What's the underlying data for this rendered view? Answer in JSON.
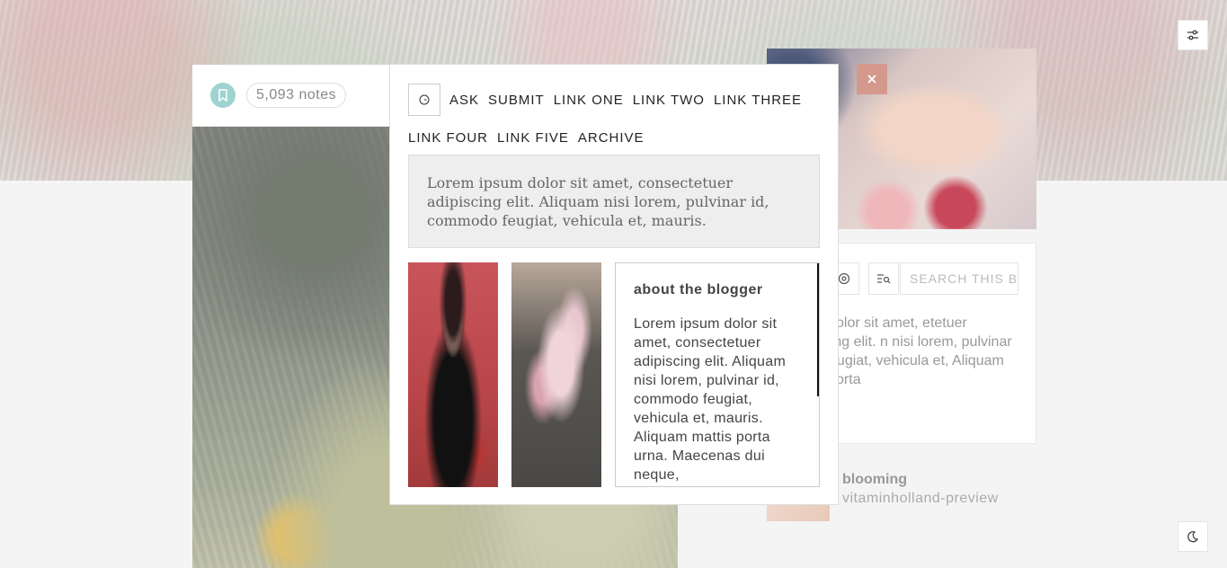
{
  "post": {
    "notes_label": "5,093 notes"
  },
  "modal": {
    "nav_links": [
      "ASK",
      "SUBMIT",
      "LINK ONE",
      "LINK TWO",
      "LINK THREE",
      "LINK FOUR",
      "LINK FIVE",
      "ARCHIVE"
    ],
    "description": "Lorem ipsum dolor sit amet, consectetuer adipiscing elit. Aliquam nisi lorem, pulvinar id, commodo feugiat, vehicula et, mauris.",
    "about": {
      "title": "about the blogger",
      "text": "Lorem ipsum dolor sit amet, consectetuer adipiscing elit. Aliquam nisi lorem, pulvinar id, commodo feugiat, vehicula et, mauris. Aliquam mattis porta urna. Maecenas dui neque,"
    }
  },
  "sidebar": {
    "search_placeholder": "SEARCH THIS BLOG",
    "text": "ipsum dolor sit amet, etetuer adipiscing elit. n nisi lorem, pulvinar id, do feugiat, vehicula et, Aliquam mattis porta",
    "blog_title": "blooming",
    "blog_url": "vitaminholland-preview"
  },
  "icons": {
    "settings": "sliders-icon",
    "theme": "moon-icon",
    "close": "close-icon",
    "home": "clock-icon",
    "bookmark": "bookmark-icon"
  },
  "colors": {
    "bookmark_bg": "#9fd3cf",
    "close_bg": "#d4998c"
  }
}
